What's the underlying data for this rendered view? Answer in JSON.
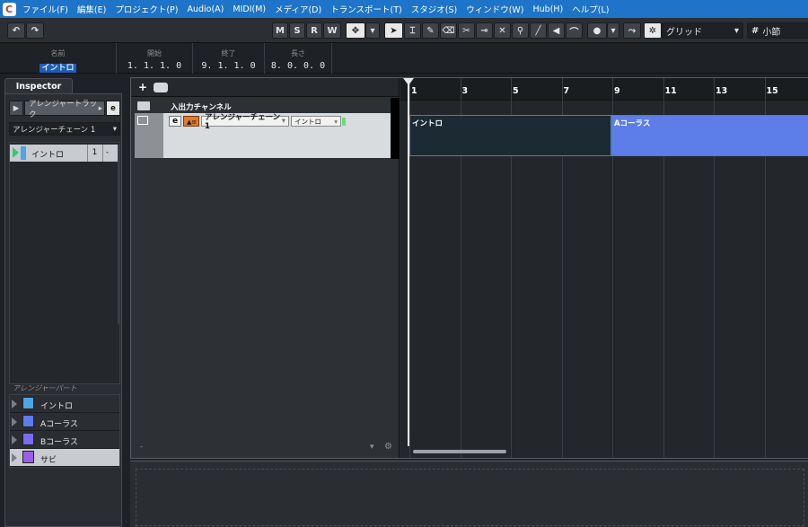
{
  "menu": [
    "ファイル(F)",
    "編集(E)",
    "プロジェクト(P)",
    "Audio(A)",
    "MIDI(M)",
    "メディア(D)",
    "トランスポート(T)",
    "スタジオ(S)",
    "ウィンドウ(W)",
    "Hub(H)",
    "ヘルプ(L)"
  ],
  "toolbar": {
    "m": "M",
    "s": "S",
    "r": "R",
    "w": "W",
    "snap_mode": "グリッド",
    "quantize": "小節",
    "hash": "#"
  },
  "info": {
    "name_label": "名前",
    "name_value": "イントロ",
    "start_label": "開始",
    "start_value": "1. 1. 1.  0",
    "end_label": "終了",
    "end_value": "9. 1. 1.  0",
    "length_label": "長さ",
    "length_value": "8. 0. 0.  0"
  },
  "inspector": {
    "tab": "Inspector",
    "track_name": "アレンジャートラック",
    "chain": "アレンジャーチェーン 1",
    "chain_entry": "イントロ",
    "chain_repeat": "1",
    "parts_header": "アレンジャーパート",
    "parts": [
      {
        "name": "イントロ",
        "color": "#4aa6e8"
      },
      {
        "name": "Aコーラス",
        "color": "#5d7cf0"
      },
      {
        "name": "Bコーラス",
        "color": "#7a6cf0"
      },
      {
        "name": "サビ",
        "color": "#9b5ee8"
      }
    ]
  },
  "tracks": {
    "io_channel": "入出力チャンネル",
    "arranger_chain": "アレンジャーチェーン 1",
    "arranger_mode": "イントロ",
    "e_label": "e",
    "bottom_dash": "-"
  },
  "ruler": [
    "1",
    "3",
    "5",
    "7",
    "9",
    "11",
    "13",
    "15"
  ],
  "timeline_parts": [
    {
      "name": "イントロ",
      "color": "#1c2a33"
    },
    {
      "name": "Aコーラス",
      "color": "#5d7ee8"
    }
  ]
}
